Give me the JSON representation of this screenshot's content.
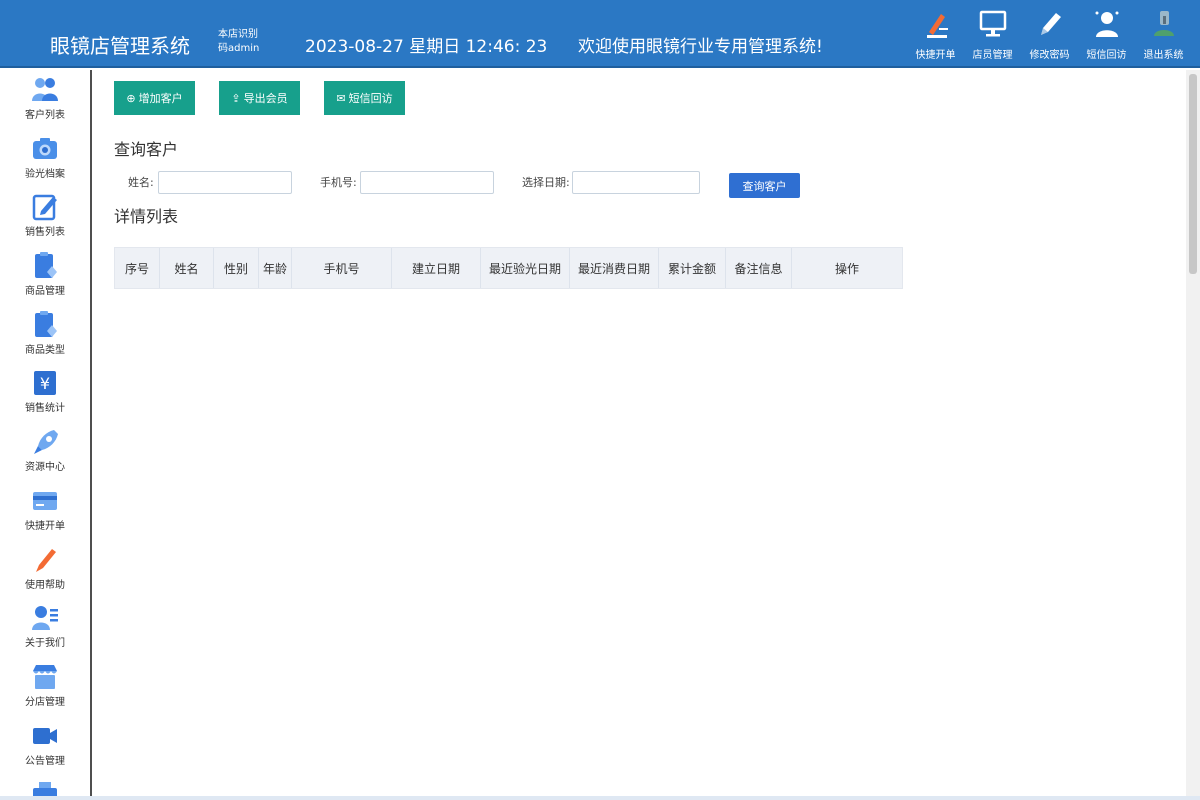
{
  "header": {
    "brand": "眼镜店管理系统",
    "store_id_line1": "本店识别",
    "store_id_line2": "码admin",
    "datetime": "2023-08-27 星期日 12:46: 23",
    "welcome": "欢迎使用眼镜行业专用管理系统!",
    "tools": [
      {
        "label": "快捷开单",
        "icon": "pen-icon"
      },
      {
        "label": "店员管理",
        "icon": "monitor-icon"
      },
      {
        "label": "修改密码",
        "icon": "pencil-icon"
      },
      {
        "label": "短信回访",
        "icon": "user-icon"
      },
      {
        "label": "退出系统",
        "icon": "logout-icon"
      }
    ]
  },
  "sidebar": {
    "items": [
      {
        "label": "客户列表",
        "icon": "users-icon"
      },
      {
        "label": "验光档案",
        "icon": "camera-icon"
      },
      {
        "label": "销售列表",
        "icon": "edit-icon"
      },
      {
        "label": "商品管理",
        "icon": "clipboard-icon"
      },
      {
        "label": "商品类型",
        "icon": "clipboard-icon"
      },
      {
        "label": "销售统计",
        "icon": "yen-icon"
      },
      {
        "label": "资源中心",
        "icon": "rocket-icon"
      },
      {
        "label": "快捷开单",
        "icon": "card-icon"
      },
      {
        "label": "使用帮助",
        "icon": "pen-icon"
      },
      {
        "label": "关于我们",
        "icon": "user-list-icon"
      },
      {
        "label": "分店管理",
        "icon": "store-icon"
      },
      {
        "label": "公告管理",
        "icon": "video-icon"
      },
      {
        "label": "",
        "icon": "printer-icon"
      }
    ]
  },
  "actions": {
    "add_customer": "增加客户",
    "export_members": "导出会员",
    "sms_followup": "短信回访"
  },
  "query": {
    "title": "查询客户",
    "name_label": "姓名:",
    "phone_label": "手机号:",
    "date_label": "选择日期:",
    "name_value": "",
    "phone_value": "",
    "date_value": "",
    "submit": "查询客户"
  },
  "list": {
    "title": "详情列表",
    "columns": [
      "序号",
      "姓名",
      "性别",
      "年龄",
      "手机号",
      "建立日期",
      "最近验光日期",
      "最近消费日期",
      "累计金额",
      "备注信息",
      "操作"
    ]
  },
  "colors": {
    "header_bg": "#2b78c4",
    "action_green": "#17a08c",
    "query_blue": "#2f6fd2"
  }
}
